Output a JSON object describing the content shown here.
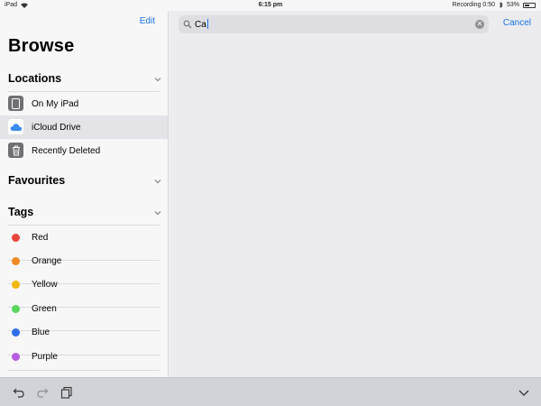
{
  "status_bar": {
    "device": "iPad",
    "time": "6:15 pm",
    "recording": "Recording 0:50",
    "battery": "53%",
    "battery_level": 0.53
  },
  "sidebar": {
    "edit_label": "Edit",
    "title": "Browse",
    "locations": {
      "header": "Locations",
      "items": [
        {
          "label": "On My iPad",
          "icon": "ipad-icon"
        },
        {
          "label": "iCloud Drive",
          "icon": "icloud-icon",
          "selected": true
        },
        {
          "label": "Recently Deleted",
          "icon": "trash-icon"
        }
      ]
    },
    "favourites": {
      "header": "Favourites"
    },
    "tags": {
      "header": "Tags",
      "items": [
        {
          "label": "Red",
          "color": "#e8453c"
        },
        {
          "label": "Orange",
          "color": "#f08a24"
        },
        {
          "label": "Yellow",
          "color": "#f2b705"
        },
        {
          "label": "Green",
          "color": "#5ad65a"
        },
        {
          "label": "Blue",
          "color": "#2f6fe8"
        },
        {
          "label": "Purple",
          "color": "#b65ce0"
        }
      ]
    }
  },
  "search": {
    "query": "Ca",
    "cancel_label": "Cancel"
  },
  "toolbar": {
    "icons": [
      "undo-icon",
      "redo-icon",
      "paste-icon",
      "keyboard-dismiss-icon"
    ]
  },
  "colors": {
    "accent": "#1a73e8"
  }
}
